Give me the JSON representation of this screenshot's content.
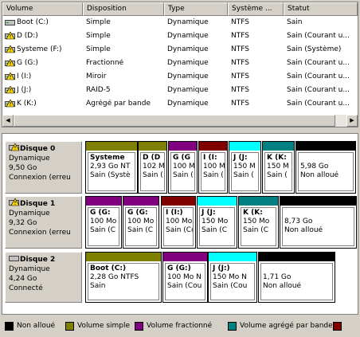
{
  "list": {
    "columns": [
      "Volume",
      "Disposition",
      "Type",
      "Système ...",
      "Statut"
    ],
    "rows": [
      {
        "volume": "Boot (C:)",
        "disposition": "Simple",
        "type": "Dynamique",
        "fs": "NTFS",
        "statut": "Sain",
        "icon": "drive-icon"
      },
      {
        "volume": "D (D:)",
        "disposition": "Simple",
        "type": "Dynamique",
        "fs": "NTFS",
        "statut": "Sain (Courant u...",
        "icon": "drive-warning-icon"
      },
      {
        "volume": "Systeme (F:)",
        "disposition": "Simple",
        "type": "Dynamique",
        "fs": "NTFS",
        "statut": "Sain (Système)",
        "icon": "drive-warning-icon"
      },
      {
        "volume": "G (G:)",
        "disposition": "Fractionné",
        "type": "Dynamique",
        "fs": "NTFS",
        "statut": "Sain (Courant u...",
        "icon": "drive-warning-icon"
      },
      {
        "volume": "I (I:)",
        "disposition": "Miroir",
        "type": "Dynamique",
        "fs": "NTFS",
        "statut": "Sain (Courant u...",
        "icon": "drive-warning-icon"
      },
      {
        "volume": "J (J:)",
        "disposition": "RAID-5",
        "type": "Dynamique",
        "fs": "NTFS",
        "statut": "Sain (Courant u...",
        "icon": "drive-warning-icon"
      },
      {
        "volume": "K (K:)",
        "disposition": "Agrégé par bande",
        "type": "Dynamique",
        "fs": "NTFS",
        "statut": "Sain (Courant u...",
        "icon": "drive-warning-icon"
      }
    ]
  },
  "disks": [
    {
      "name": "Disque 0",
      "type": "Dynamique",
      "size": "9,50 Go",
      "state": "Connexion (erreu",
      "partitions": [
        {
          "title": "Systeme",
          "line2": "2,93 Go NT",
          "line3": "Sain (Systè",
          "color": "#808000"
        },
        {
          "title": "D (D",
          "line2": "102 M",
          "line3": "Sain (",
          "color": "#808000"
        },
        {
          "title": "G (G",
          "line2": "100 M",
          "line3": "Sain (",
          "color": "#800080"
        },
        {
          "title": "I (I:",
          "line2": "100 M",
          "line3": "Sain (",
          "color": "#800000"
        },
        {
          "title": "J (J:",
          "line2": "150 M",
          "line3": "Sain (",
          "color": "#00ffff"
        },
        {
          "title": "K (K:",
          "line2": "150 M",
          "line3": "Sain (",
          "color": "#008080"
        },
        {
          "title": "",
          "line2": "5,98 Go",
          "line3": "Non alloué",
          "color": "#000000"
        }
      ]
    },
    {
      "name": "Disque 1",
      "type": "Dynamique",
      "size": "9,32 Go",
      "state": "Connexion (erreu",
      "partitions": [
        {
          "title": "G (G:",
          "line2": "100 Mo",
          "line3": "Sain (C",
          "color": "#800080"
        },
        {
          "title": "G (G:",
          "line2": "100 Mo",
          "line3": "Sain (C",
          "color": "#800080"
        },
        {
          "title": "I (I:)",
          "line2": "100 Mo",
          "line3": "Sain (Co",
          "color": "#800000"
        },
        {
          "title": "J (J:",
          "line2": "150 Mo",
          "line3": "Sain (C",
          "color": "#00ffff"
        },
        {
          "title": "K (K:",
          "line2": "150 Mo",
          "line3": "Sain (C",
          "color": "#008080"
        },
        {
          "title": "",
          "line2": "8,73 Go",
          "line3": "Non alloué",
          "color": "#000000"
        }
      ]
    },
    {
      "name": "Disque 2",
      "type": "Dynamique",
      "size": "4,24 Go",
      "state": "Connecté",
      "partitions": [
        {
          "title": "Boot  (C:)",
          "line2": "2,28 Go NTFS",
          "line3": "Sain",
          "color": "#808000"
        },
        {
          "title": "G (G:)",
          "line2": "100 Mo N",
          "line3": "Sain (Cou",
          "color": "#800080"
        },
        {
          "title": "J (J:)",
          "line2": "150 Mo N",
          "line3": "Sain (Cou",
          "color": "#00ffff"
        },
        {
          "title": "",
          "line2": "1,71 Go",
          "line3": "Non alloué",
          "color": "#000000"
        }
      ]
    }
  ],
  "legend": [
    {
      "label": "Non alloué",
      "color": "#000000"
    },
    {
      "label": "Volume simple",
      "color": "#808000"
    },
    {
      "label": "Volume fractionné",
      "color": "#800080"
    },
    {
      "label": "Volume agrégé par bande",
      "color": "#008080"
    },
    {
      "label": "",
      "color": "#800000"
    }
  ]
}
